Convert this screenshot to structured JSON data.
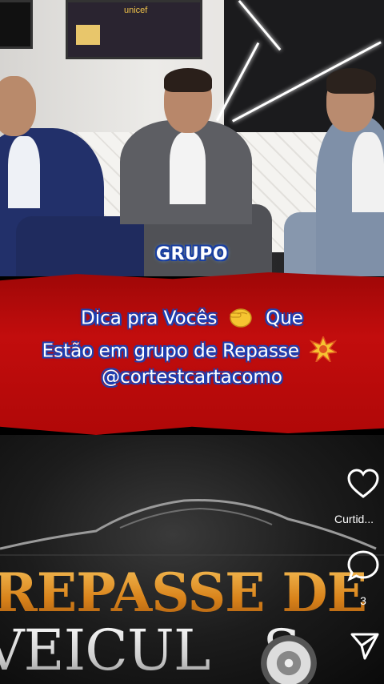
{
  "video": {
    "sticker": "GRUPO",
    "caption_lines": [
      "Dica pra Vocês",
      "Que",
      "Estão em grupo de Repasse",
      "@cortestcartacomo"
    ],
    "background_logo": {
      "line1": "REPASSE DE",
      "line2": "VEICUL",
      "line2_end": "S"
    },
    "frame_logo_text": "unicef"
  },
  "actions": {
    "like_icon": "heart-icon",
    "like_label": "Curtid...",
    "comment_icon": "comment-icon",
    "comment_count": "3",
    "share_icon": "send-icon"
  },
  "colors": {
    "banner_red": "#b50a0a",
    "caption_outline": "#1d3fb0",
    "logo_gold": "#e2961f"
  }
}
